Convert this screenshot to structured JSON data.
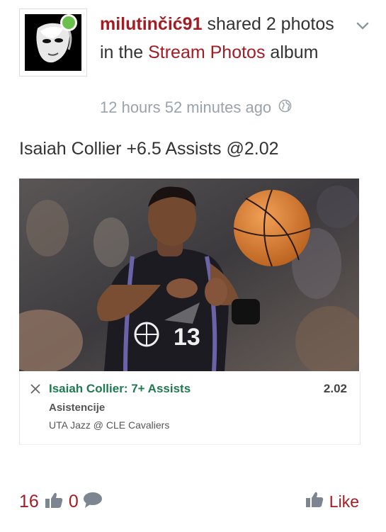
{
  "post": {
    "username": "milutinčić91",
    "action_text": " shared 2 photos in the ",
    "album_name": "Stream Photos",
    "album_suffix": " album",
    "timestamp": "12 hours 52 minutes ago",
    "body_text": "Isaiah Collier +6.5 Assists @2.02"
  },
  "bet_card": {
    "selection": "Isaiah Collier: 7+ Assists",
    "odds": "2.02",
    "market": "Asistencije",
    "event": "UTA Jazz @ CLE Cavaliers"
  },
  "photo": {
    "jersey_number": "13"
  },
  "footer": {
    "likes_count": "16",
    "comments_count": "0",
    "like_label": "Like"
  },
  "colors": {
    "brand_red": "#a31c24",
    "bet_green": "#1f7a4f",
    "online_green": "#6ac04a",
    "muted_gray": "#9aa2ab"
  },
  "icons": {
    "online": "online-status-icon",
    "menu": "chevron-down-icon",
    "privacy": "globe-icon",
    "remove": "close-icon",
    "like": "thumbs-up-icon",
    "comment": "comment-bubble-icon"
  }
}
